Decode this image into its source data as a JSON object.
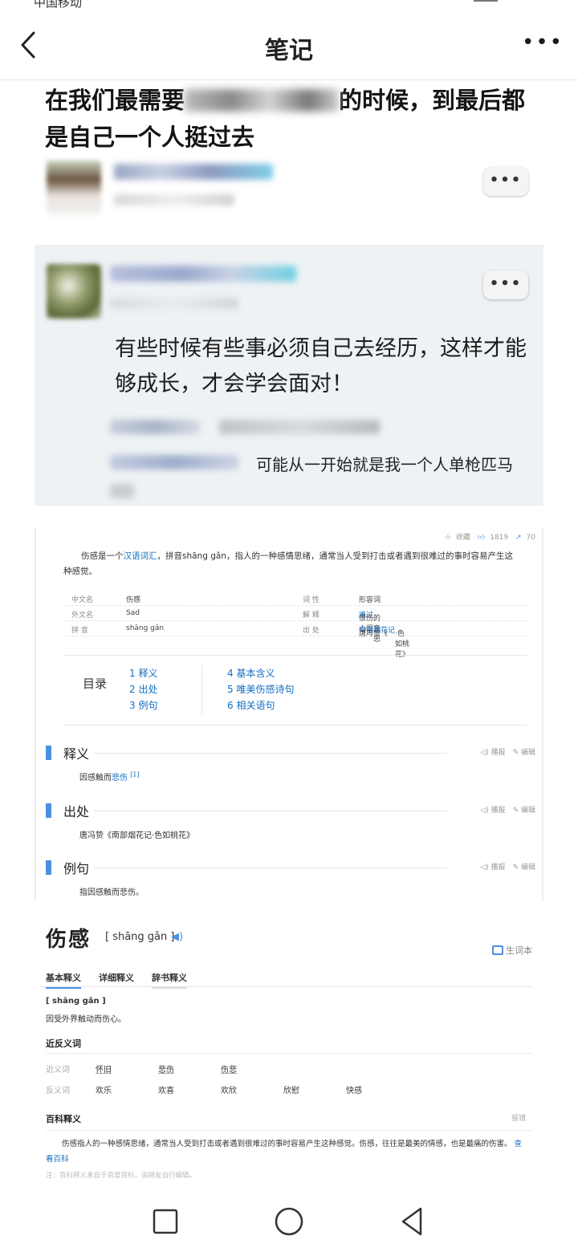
{
  "status_bar": {
    "carrier": "中国移动"
  },
  "header": {
    "title": "笔记"
  },
  "post1": {
    "title_pre": "在我们最需要",
    "title_post": "的时候，到最后都是自己一个人挺过去"
  },
  "post2": {
    "text": "有些时候有些事必须自己去经历，这样才能够成长，才会学会面对！",
    "reply": "可能从一开始就是我一个人单枪匹马"
  },
  "baike": {
    "stats": {
      "collect": "收藏",
      "likes": "1819",
      "shares": "70"
    },
    "intro_pre": "伤感是一个",
    "intro_link": "汉语词汇",
    "intro_post": "，拼音shāng gǎn，指人的一种感情思绪，通常当人受到打击或者遇到很难过的事时容易产生这种感觉。",
    "info": [
      {
        "k1": "中文名",
        "v1": "伤感",
        "k2": "词 性",
        "v2": "形容词"
      },
      {
        "k1": "外文名",
        "v1": "Sad",
        "k2": "解 释",
        "v2_pre": "很伤心很",
        "v2_link": "难过",
        "v2_post": "的意思"
      },
      {
        "k1": "拼 音",
        "v1": "shāng gǎn",
        "k2": "出 处",
        "v2_pre": "唐冯贽《",
        "v2_link": "南部烟花记",
        "v2_post": "·色如桃花》"
      }
    ],
    "toc_label": "目录",
    "toc_left": [
      "1 释义",
      "2 出处",
      "3 例句"
    ],
    "toc_right": [
      "4 基本含义",
      "5 唯美伤感诗句",
      "6 相关语句"
    ],
    "actions": {
      "report": "播报",
      "edit": "编辑"
    },
    "sections": [
      {
        "title": "释义",
        "body_pre": "因感触而",
        "body_link": "悲伤",
        "body_sup": "[1]"
      },
      {
        "title": "出处",
        "body": "唐冯贽《南部烟花记·色如桃花》"
      },
      {
        "title": "例句",
        "body": "指因感触而悲伤。"
      }
    ]
  },
  "dict": {
    "word": "伤感",
    "pinyin": "[ shāng gǎn ]",
    "wordbook": "生词本",
    "tabs": [
      "基本释义",
      "详细释义",
      "辞书释义"
    ],
    "def_pinyin": "[ shāng gǎn ]",
    "definition": "因受外界触动而伤心。",
    "syn_heading": "近反义词",
    "syn_label": "近义词",
    "synonyms": [
      "怀旧",
      "悲伤",
      "伤悲"
    ],
    "ant_label": "反义词",
    "antonyms": [
      "欢乐",
      "欢喜",
      "欢欣",
      "欣慰",
      "快感"
    ],
    "encyc_heading": "百科释义",
    "report": "报错",
    "encyc_text": "伤感指人的一种感情思绪，通常当人受到打击或者遇到很难过的事时容易产生这种感觉。伤感，往往是最美的情感，也是最痛的伤害。",
    "encyc_link": "查看百科",
    "note": "注：百科释义来自于百度百科，由网友自行编辑。"
  },
  "colors": {
    "accent": "#4a90e2",
    "link": "#136ec2",
    "quote_bg": "#eef2f5"
  }
}
